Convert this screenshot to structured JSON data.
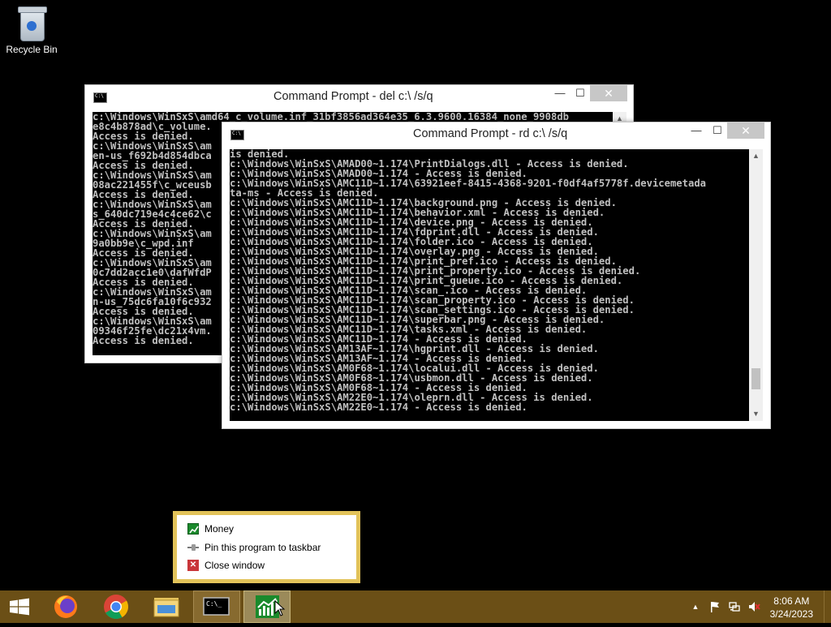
{
  "desktop": {
    "icons": [
      {
        "label": "Recycle Bin",
        "icon": "recycle-bin-icon"
      }
    ]
  },
  "window_del": {
    "title": "Command Prompt - del  c:\\ /s/q",
    "controls": {
      "minimize": "—",
      "maximize": "☐",
      "close": "✕"
    },
    "lines": [
      "c:\\Windows\\WinSxS\\amd64_c_volume.inf_31bf3856ad364e35_6.3.9600.16384_none_9908db",
      "e8c4b878ad\\c_volume.",
      "Access is denied.",
      "c:\\Windows\\WinSxS\\am",
      "en-us_f692b4d854dbca",
      "Access is denied.",
      "c:\\Windows\\WinSxS\\am",
      "08ac221455f\\c_wceusb",
      "Access is denied.",
      "c:\\Windows\\WinSxS\\am",
      "s_640dc719e4c4ce62\\c",
      "Access is denied.",
      "c:\\Windows\\WinSxS\\am",
      "9a0bb9e\\c_wpd.inf",
      "Access is denied.",
      "c:\\Windows\\WinSxS\\am",
      "0c7dd2acc1e0\\dafWfdP",
      "Access is denied.",
      "c:\\Windows\\WinSxS\\am",
      "n-us_75dc6fa10f6c932",
      "Access is denied.",
      "c:\\Windows\\WinSxS\\am",
      "09346f25fe\\dc21x4vm.",
      "Access is denied."
    ]
  },
  "window_rd": {
    "title": "Command Prompt - rd  c:\\ /s/q",
    "controls": {
      "minimize": "—",
      "maximize": "☐",
      "close": "✕"
    },
    "lines": [
      "is denied.",
      "c:\\Windows\\WinSxS\\AMAD00~1.174\\PrintDialogs.dll - Access is denied.",
      "c:\\Windows\\WinSxS\\AMAD00~1.174 - Access is denied.",
      "c:\\Windows\\WinSxS\\AMC11D~1.174\\63921eef-8415-4368-9201-f0df4af5778f.devicemetada",
      "ta-ms - Access is denied.",
      "c:\\Windows\\WinSxS\\AMC11D~1.174\\background.png - Access is denied.",
      "c:\\Windows\\WinSxS\\AMC11D~1.174\\behavior.xml - Access is denied.",
      "c:\\Windows\\WinSxS\\AMC11D~1.174\\device.png - Access is denied.",
      "c:\\Windows\\WinSxS\\AMC11D~1.174\\fdprint.dll - Access is denied.",
      "c:\\Windows\\WinSxS\\AMC11D~1.174\\folder.ico - Access is denied.",
      "c:\\Windows\\WinSxS\\AMC11D~1.174\\overlay.png - Access is denied.",
      "c:\\Windows\\WinSxS\\AMC11D~1.174\\print_pref.ico - Access is denied.",
      "c:\\Windows\\WinSxS\\AMC11D~1.174\\print_property.ico - Access is denied.",
      "c:\\Windows\\WinSxS\\AMC11D~1.174\\print_queue.ico - Access is denied.",
      "c:\\Windows\\WinSxS\\AMC11D~1.174\\scan_.ico - Access is denied.",
      "c:\\Windows\\WinSxS\\AMC11D~1.174\\scan_property.ico - Access is denied.",
      "c:\\Windows\\WinSxS\\AMC11D~1.174\\scan_settings.ico - Access is denied.",
      "c:\\Windows\\WinSxS\\AMC11D~1.174\\superbar.png - Access is denied.",
      "c:\\Windows\\WinSxS\\AMC11D~1.174\\tasks.xml - Access is denied.",
      "c:\\Windows\\WinSxS\\AMC11D~1.174 - Access is denied.",
      "c:\\Windows\\WinSxS\\AM13AF~1.174\\hgprint.dll - Access is denied.",
      "c:\\Windows\\WinSxS\\AM13AF~1.174 - Access is denied.",
      "c:\\Windows\\WinSxS\\AM0F68~1.174\\localui.dll - Access is denied.",
      "c:\\Windows\\WinSxS\\AM0F68~1.174\\usbmon.dll - Access is denied.",
      "c:\\Windows\\WinSxS\\AM0F68~1.174 - Access is denied.",
      "c:\\Windows\\WinSxS\\AM22E0~1.174\\oleprn.dll - Access is denied.",
      "c:\\Windows\\WinSxS\\AM22E0~1.174 - Access is denied."
    ],
    "scroll_position": 0.92
  },
  "jumplist": {
    "items": [
      {
        "label": "Money",
        "icon": "money-icon"
      },
      {
        "label": "Pin this program to taskbar",
        "icon": "pin-icon"
      },
      {
        "label": "Close window",
        "icon": "close-icon"
      }
    ]
  },
  "taskbar": {
    "apps": [
      {
        "name": "firefox",
        "icon": "firefox-icon"
      },
      {
        "name": "chrome",
        "icon": "chrome-icon"
      },
      {
        "name": "file-explorer",
        "icon": "folder-icon"
      },
      {
        "name": "command-prompt",
        "icon": "cmd-icon"
      },
      {
        "name": "money",
        "icon": "money-icon"
      }
    ],
    "tray": {
      "chevron": "▲",
      "time": "8:06 AM",
      "date": "3/24/2023"
    },
    "colors": {
      "taskbar": "#6b4f16",
      "jumplist_border": "#e2c35a"
    }
  }
}
